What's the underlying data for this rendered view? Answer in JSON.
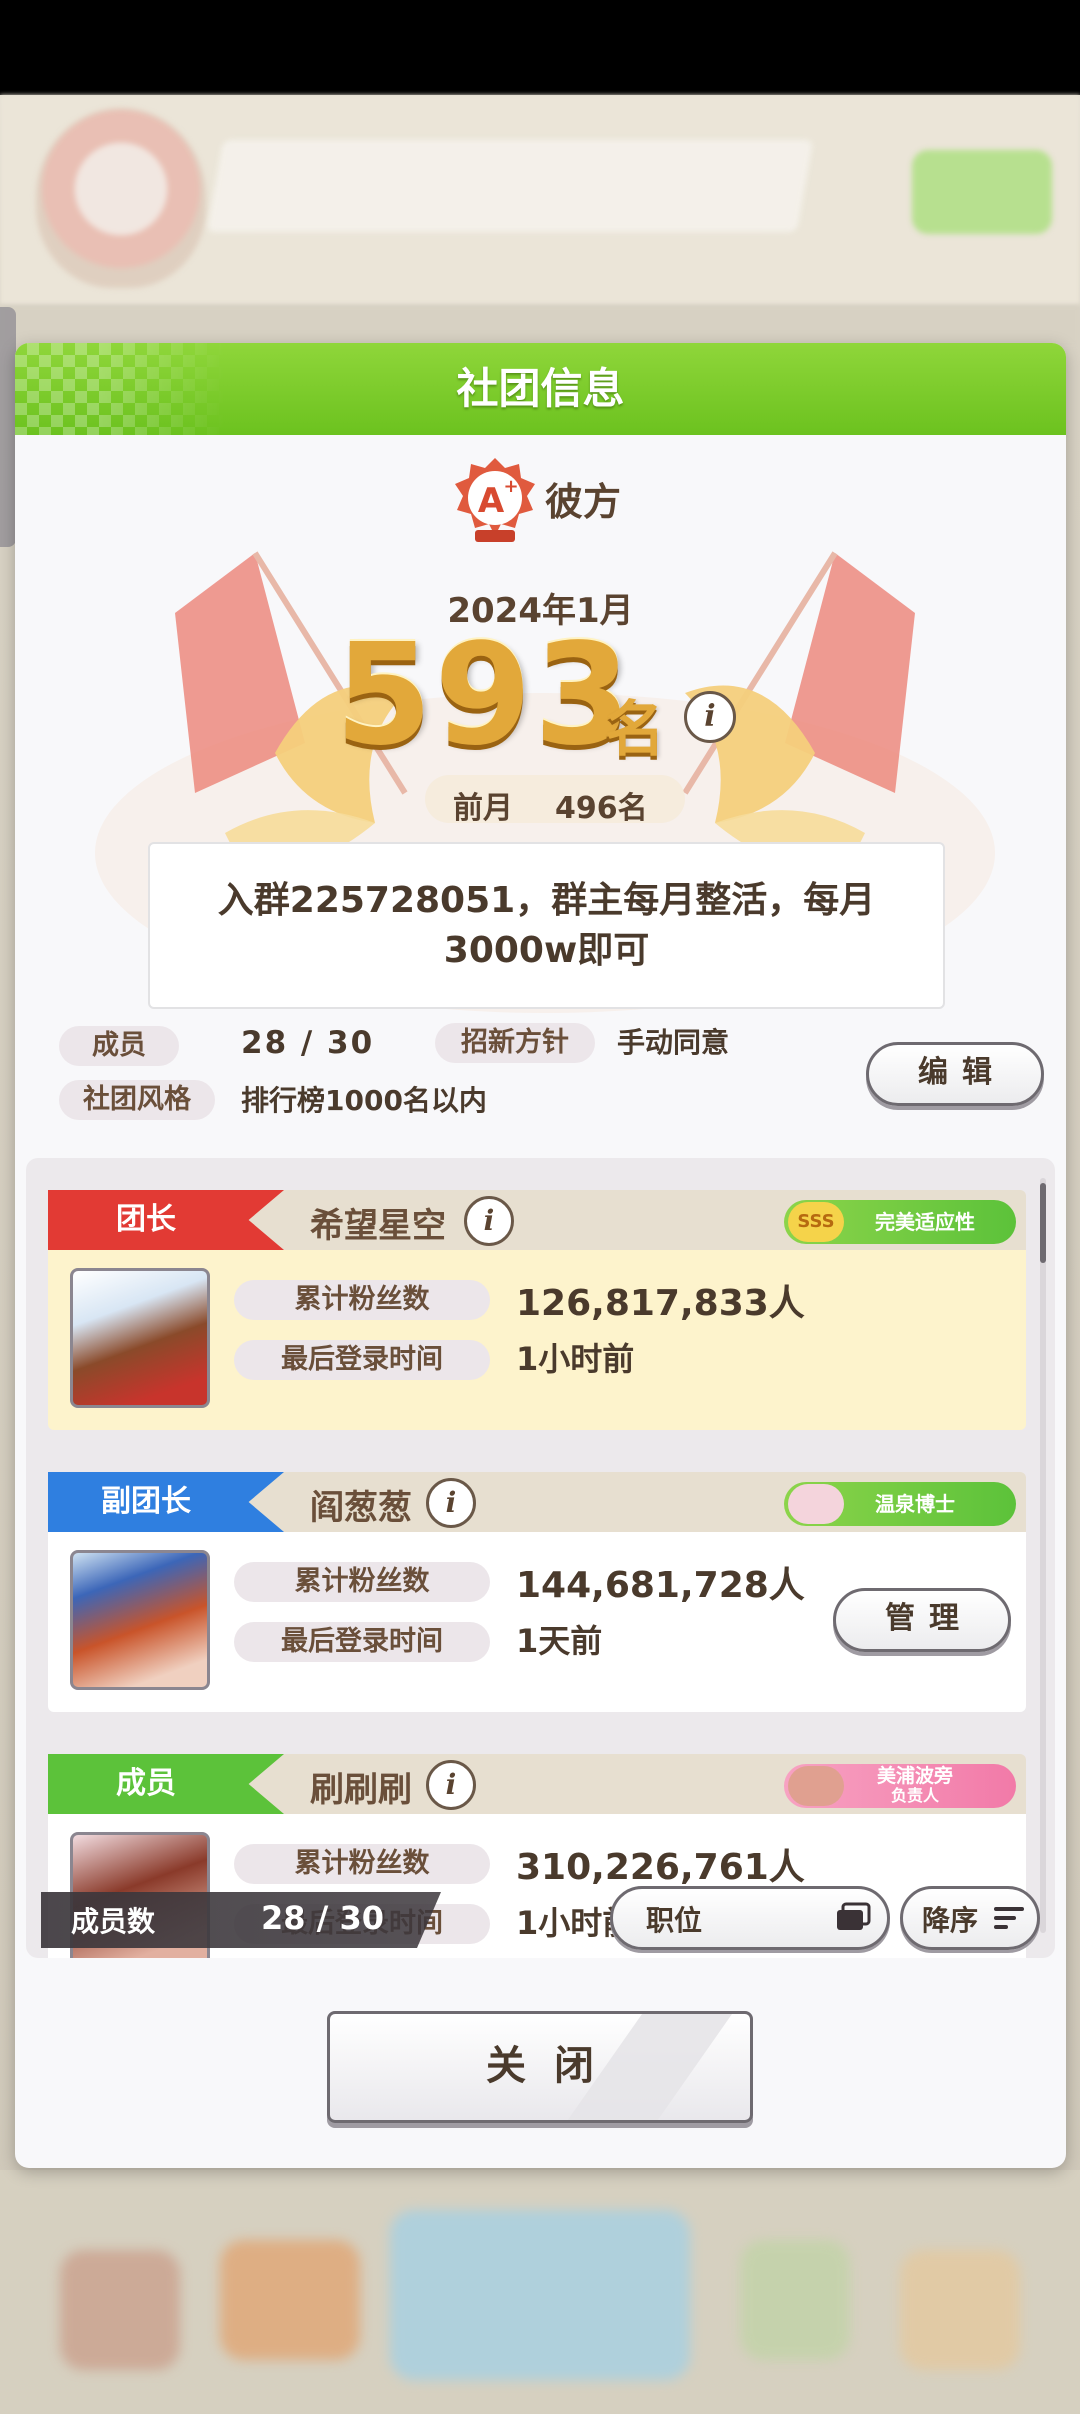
{
  "dialog": {
    "title": "社团信息"
  },
  "club": {
    "name": "彼方",
    "rank_date": "2024年1月",
    "rank": "593",
    "rank_unit": "名",
    "prev_label": "前月",
    "prev_rank": "496名",
    "description": "入群225728051，群主每月整活，每月3000w即可",
    "members_label": "成员",
    "members_value": "28 / 30",
    "policy_label": "招新方针",
    "policy_value": "手动同意",
    "style_label": "社团风格",
    "style_value": "排行榜1000名以内",
    "edit_label": "编辑"
  },
  "members": [
    {
      "role": "团长",
      "name": "希望星空",
      "badge": "完美适应性",
      "badge_icon": "SSS",
      "fans_label": "累计粉丝数",
      "fans": "126,817,833人",
      "login_label": "最后登录时间",
      "login": "1小时前"
    },
    {
      "role": "副团长",
      "name": "阎葱葱",
      "badge": "温泉博士",
      "fans_label": "累计粉丝数",
      "fans": "144,681,728人",
      "login_label": "最后登录时间",
      "login": "1天前",
      "manage_label": "管理"
    },
    {
      "role": "成员",
      "name": "刷刷刷",
      "badge": "美浦波旁",
      "badge_sub": "负责人",
      "fans_label": "累计粉丝数",
      "fans": "310,226,761人",
      "login_label": "最后登录时间",
      "login": "1小时前"
    }
  ],
  "filter": {
    "count_label": "成员数",
    "count_value": "28 / 30",
    "role_label": "职位",
    "sort_label": "降序"
  },
  "close_label": "关闭",
  "colors": {
    "header_green": "#7ccc2a",
    "leader_red": "#e23a34",
    "vice_blue": "#2f7fe0",
    "member_green": "#5cc23a",
    "rank_gold": "#e2a83a"
  }
}
